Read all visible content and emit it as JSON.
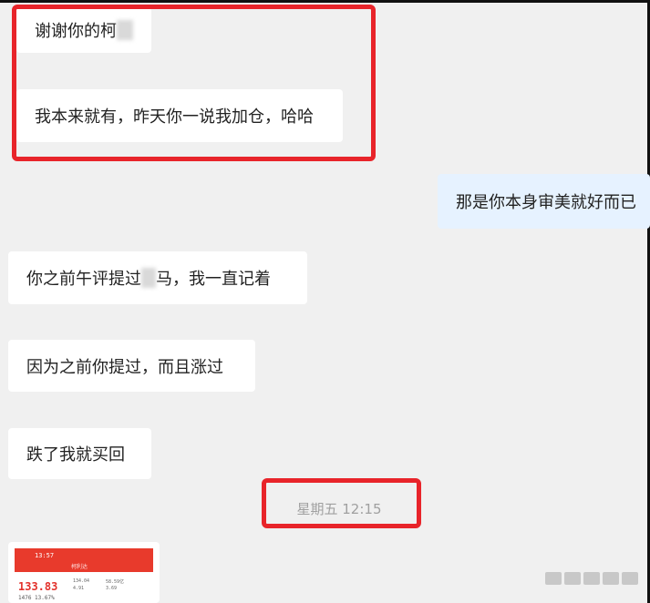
{
  "messages": [
    {
      "side": "in",
      "text": "谢谢你的柯"
    },
    {
      "side": "in",
      "text": "我本来就有，昨天你一说我加仓，哈哈"
    },
    {
      "side": "out",
      "text": "那是你本身审美就好而已"
    },
    {
      "side": "in",
      "text_before": "你之前午评提过",
      "text_after": "马，我一直记着"
    },
    {
      "side": "in",
      "text": "因为之前你提过，而且涨过"
    },
    {
      "side": "in",
      "text": "跌了我就买回"
    }
  ],
  "timestamp": "星期五 12:15",
  "image_message": {
    "status_time": "13:57",
    "title": "柯利达",
    "price": "133.83",
    "row1": "1476  13.67%",
    "mini_values": [
      "134.04",
      "4.91",
      "58.59亿",
      "3.69"
    ]
  },
  "colors": {
    "highlight": "#e8242a",
    "incoming_bubble": "#ffffff",
    "outgoing_bubble": "#e6f2ff",
    "chat_background": "#f0f0f0"
  }
}
